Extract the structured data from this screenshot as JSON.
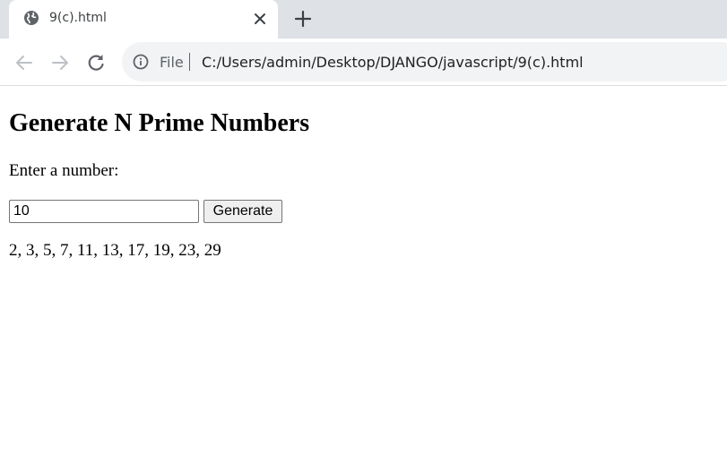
{
  "browser": {
    "tab": {
      "title": "9(c).html",
      "favicon": "globe-icon"
    },
    "toolbar": {
      "back_icon": "arrow-left-icon",
      "forward_icon": "arrow-right-icon",
      "reload_icon": "reload-icon",
      "omnibox": {
        "security_icon": "info-icon",
        "scheme_label": "File",
        "url": "C:/Users/admin/Desktop/DJANGO/javascript/9(c).html"
      }
    }
  },
  "page": {
    "heading": "Generate N Prime Numbers",
    "prompt_label": "Enter a number:",
    "input": {
      "value": "10",
      "placeholder": ""
    },
    "generate_button": "Generate",
    "result_text": "2, 3, 5, 7, 11, 13, 17, 19, 23, 29"
  },
  "colors": {
    "tab_strip_bg": "#dee1e6",
    "omnibox_bg": "#f1f3f4",
    "icon_gray": "#5f6368"
  }
}
